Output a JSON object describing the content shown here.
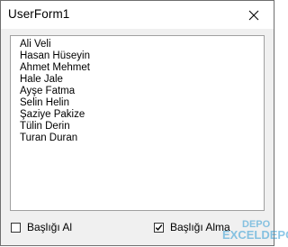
{
  "window": {
    "title": "UserForm1",
    "close_icon": "close-icon"
  },
  "listbox": {
    "items": [
      "Ali Veli",
      "Hasan Hüseyin",
      "Ahmet Mehmet",
      "Hale Jale",
      "Ayşe Fatma",
      "Selin Helin",
      "Şaziye Pakize",
      "Tülin Derin",
      "Turan Duran"
    ]
  },
  "checkboxes": [
    {
      "label": "Başlığı Al",
      "checked": false
    },
    {
      "label": "Başlığı Alma",
      "checked": true
    }
  ],
  "watermark": {
    "top": "DEPO",
    "text": "EXCELDEPO"
  },
  "colors": {
    "window_bg": "#f0f0f0",
    "watermark": "#2f9bd4"
  }
}
